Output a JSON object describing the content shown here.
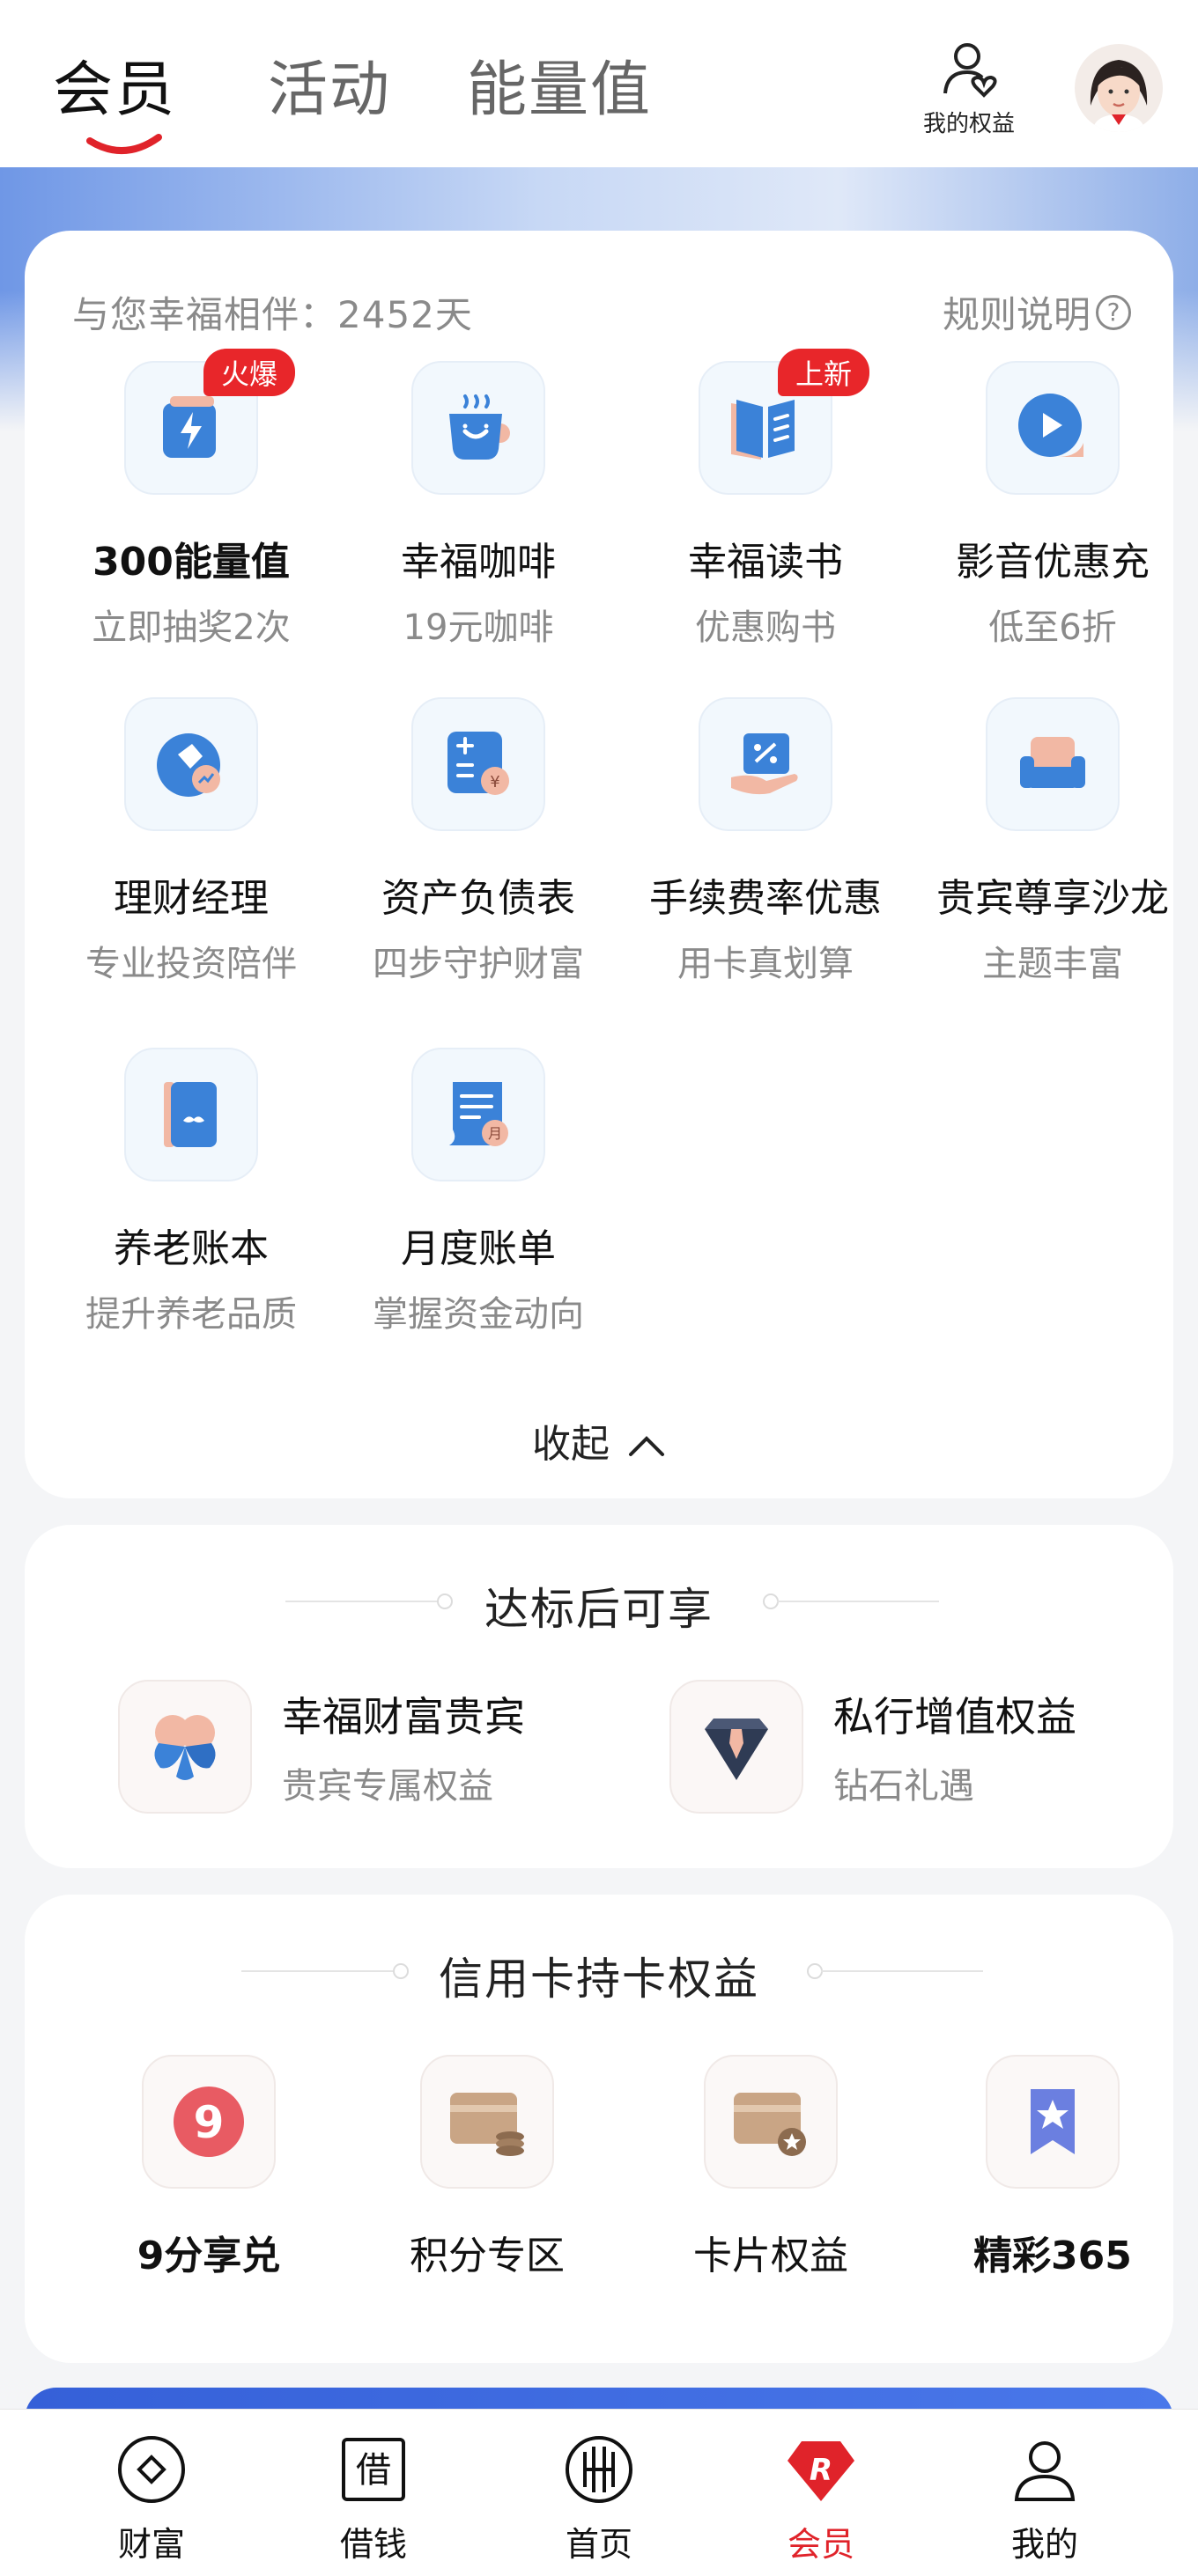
{
  "tabs": [
    {
      "label": "会员",
      "active": true
    },
    {
      "label": "活动",
      "active": false
    },
    {
      "label": "能量值",
      "active": false
    }
  ],
  "header": {
    "my_benefits_label": "我的权益"
  },
  "benefits_card": {
    "companion_text": "与您幸福相伴：2452天",
    "rules_label": "规则说明",
    "rules_icon_text": "?",
    "items": [
      {
        "title": "300能量值",
        "sub": "立即抽奖2次",
        "badge": "火爆",
        "icon": "lightning-icon"
      },
      {
        "title": "幸福咖啡",
        "sub": "19元咖啡",
        "badge": "",
        "icon": "coffee-cup-icon"
      },
      {
        "title": "幸福读书",
        "sub": "优惠购书",
        "badge": "上新",
        "icon": "book-icon"
      },
      {
        "title": "影音优惠充",
        "sub": "低至6折",
        "badge": "",
        "icon": "play-icon"
      },
      {
        "title": "理财经理",
        "sub": "专业投资陪伴",
        "badge": "",
        "icon": "advisor-icon"
      },
      {
        "title": "资产负债表",
        "sub": "四步守护财富",
        "badge": "",
        "icon": "calculator-icon"
      },
      {
        "title": "手续费率优惠",
        "sub": "用卡真划算",
        "badge": "",
        "icon": "discount-ticket-icon"
      },
      {
        "title": "贵宾尊享沙龙",
        "sub": "主题丰富",
        "badge": "",
        "icon": "sofa-icon"
      },
      {
        "title": "养老账本",
        "sub": "提升养老品质",
        "badge": "",
        "icon": "ledger-icon"
      },
      {
        "title": "月度账单",
        "sub": "掌握资金动向",
        "badge": "",
        "icon": "monthly-bill-icon"
      }
    ],
    "collapse_label": "收起"
  },
  "qualified_card": {
    "title": "达标后可享",
    "perks": [
      {
        "title": "幸福财富贵宾",
        "sub": "贵宾专属权益",
        "icon": "clover-icon"
      },
      {
        "title": "私行增值权益",
        "sub": "钻石礼遇",
        "icon": "diamond-tie-icon"
      }
    ]
  },
  "credit_card": {
    "title": "信用卡持卡权益",
    "items": [
      {
        "title": "9分享兑",
        "icon": "nine-icon",
        "icon_text": "9"
      },
      {
        "title": "积分专区",
        "icon": "points-card-icon"
      },
      {
        "title": "卡片权益",
        "icon": "card-star-icon"
      },
      {
        "title": "精彩365",
        "icon": "bookmark-star-icon"
      }
    ]
  },
  "bottom_nav": [
    {
      "label": "财富",
      "icon": "wealth-icon",
      "active": false
    },
    {
      "label": "借钱",
      "icon": "borrow-icon",
      "icon_text": "借",
      "active": false
    },
    {
      "label": "首页",
      "icon": "home-icon",
      "active": false
    },
    {
      "label": "会员",
      "icon": "member-icon",
      "icon_text": "R",
      "active": true
    },
    {
      "label": "我的",
      "icon": "profile-icon",
      "active": false
    }
  ],
  "colors": {
    "accent_red": "#e0232a",
    "icon_blue": "#3b82d8",
    "badge_red": "#e8262a"
  }
}
